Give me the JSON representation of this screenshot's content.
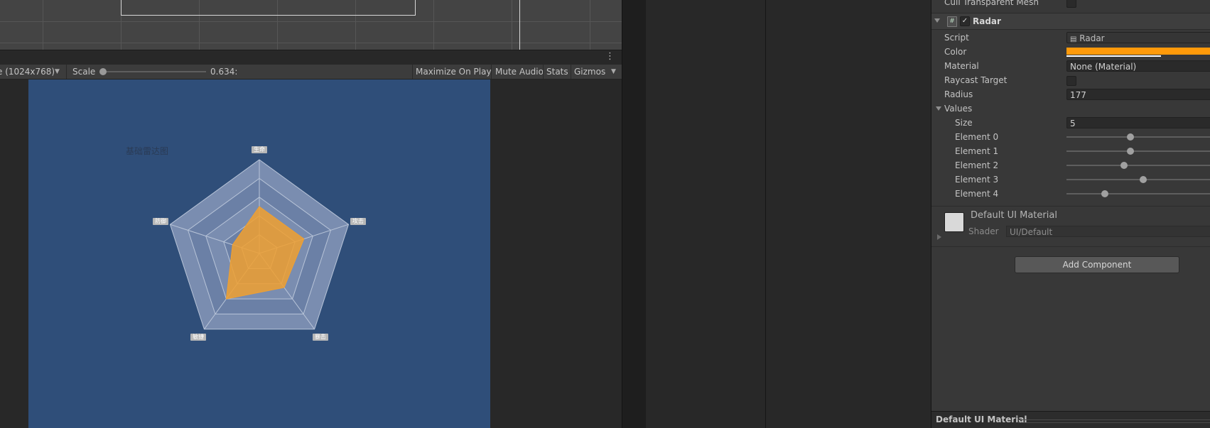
{
  "game_toolbar": {
    "resolution": "e (1024x768)",
    "scale_label": "Scale",
    "scale_value": "0.634:",
    "scale_fraction": 0.0,
    "maximize_on_play": "Maximize On Play",
    "mute_audio": "Mute Audio",
    "stats": "Stats",
    "gizmos": "Gizmos"
  },
  "radar_chart": {
    "title": "基础雷达图",
    "fill_color": "#f0a030",
    "ring_count": 5,
    "axes": [
      {
        "name": "生命",
        "value": 0.5
      },
      {
        "name": "攻击",
        "value": 0.5
      },
      {
        "name": "暴击",
        "value": 0.45
      },
      {
        "name": "敏捷",
        "value": 0.6
      },
      {
        "name": "防御",
        "value": 0.3
      }
    ]
  },
  "inspector": {
    "cull_label": "Cull Transparent Mesh",
    "component_title": "Radar",
    "component_icon": "#",
    "enable_mark": "✓",
    "props": {
      "script_label": "Script",
      "script_value": "Radar",
      "color_label": "Color",
      "color_value": "#ff9a0a",
      "material_label": "Material",
      "material_value": "None (Material)",
      "raycast_label": "Raycast Target",
      "radius_label": "Radius",
      "radius_value": "177",
      "values_label": "Values",
      "size_label": "Size",
      "size_value": "5"
    },
    "elements": [
      {
        "label": "Element 0",
        "value": 0.5
      },
      {
        "label": "Element 1",
        "value": 0.5
      },
      {
        "label": "Element 2",
        "value": 0.45
      },
      {
        "label": "Element 3",
        "value": 0.6
      },
      {
        "label": "Element 4",
        "value": 0.3
      }
    ],
    "material": {
      "name": "Default UI Material",
      "shader_label": "Shader",
      "shader_value": "UI/Default"
    },
    "add_component": "Add Component",
    "preview_title": "Default UI Material"
  }
}
